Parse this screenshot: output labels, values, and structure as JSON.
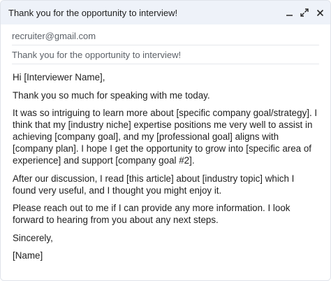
{
  "window": {
    "title": "Thank you for the opportunity to interview!"
  },
  "icons": {
    "minimize": "minimize-icon",
    "expand": "expand-icon",
    "close": "close-icon"
  },
  "fields": {
    "to": "recruiter@gmail.com",
    "subject": "Thank you for the opportunity to interview!"
  },
  "body": {
    "greeting": "Hi [Interviewer Name],",
    "p1": "Thank you so much for speaking with me today.",
    "p2": "It was so intriguing to learn more about [specific company goal/strategy]. I think that my [industry niche] expertise positions me very well to assist in achieving [company goal], and my [professional goal] aligns with [company plan]. I hope I get the opportunity to grow into [specific area of experience] and support [company goal #2].",
    "p3": "After our discussion, I read [this article] about [industry topic] which I found very useful, and I thought you might enjoy it.",
    "p4": "Please reach out to me if I can provide any more information. I look forward to hearing from you about any next steps.",
    "closing": "Sincerely,",
    "signature": "[Name]"
  }
}
